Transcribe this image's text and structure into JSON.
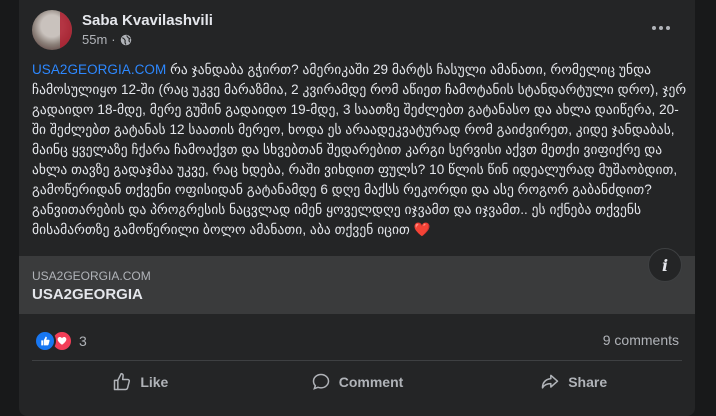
{
  "post": {
    "author": "Saba Kvavilashvili",
    "time": "55m",
    "audience_icon": "globe-icon",
    "link_text": "USA2GEORGIA.COM",
    "body": " რა ჯანდაბა გჭირთ? ამერიკაში 29 მარტს ჩასული ამანათი, რომელიც უნდა ჩამოსულიყო 12-ში (რაც უკვე მარაზმია, 2 კვირამდე რომ აწიეთ ჩამოტანის სტანდარტული დრო), ჯერ გადაიდო 18-მდე, მერე გუშინ გადაიდო 19-მდე, 3 საათზე შეძლებთ გატანასო და ახლა დაიწერა, 20-ში შეძლებთ გატანას 12 საათის მერეო, ხოდა ეს არაადეკვატურად რომ გაიძვირეთ, კიდე ჯანდაბას, მაინც ყველაზე ჩქარა ჩამოაქვთ და სხვებთან შედარებით კარგი სერვისი აქვთ მეთქი ვიფიქრე და ახლა თავზე გადაჯმაა უკვე, რაც ხდება, რაში ვიხდით ფულს? 10 წლის წინ იდეალურად მუშაობდით, გამოწერიდან თქვენი ოფისიდან გატანამდე 6 დღე მაქსს რეკორდი და ასე როგორ გაბანძდით? განვითარების და პროგრესის ნაცვლად იმენ ყოველდღე იჯვამთ და იჯვამთ.. ეს იქნება თქვენს მისამართზე გამოწერილი ბოლო ამანათი, აბა თქვენ იცით ❤️"
  },
  "link_preview": {
    "domain": "USA2GEORGIA.COM",
    "title": "USA2GEORGIA"
  },
  "reactions": {
    "icons": [
      "like-icon",
      "love-icon"
    ],
    "count": "3"
  },
  "comments_count": "9 comments",
  "actions": {
    "like": "Like",
    "comment": "Comment",
    "share": "Share"
  },
  "colors": {
    "background": "#18191a",
    "card": "#242526",
    "link": "#2d88ff",
    "like": "#1877f2",
    "love": "#f33e58"
  }
}
